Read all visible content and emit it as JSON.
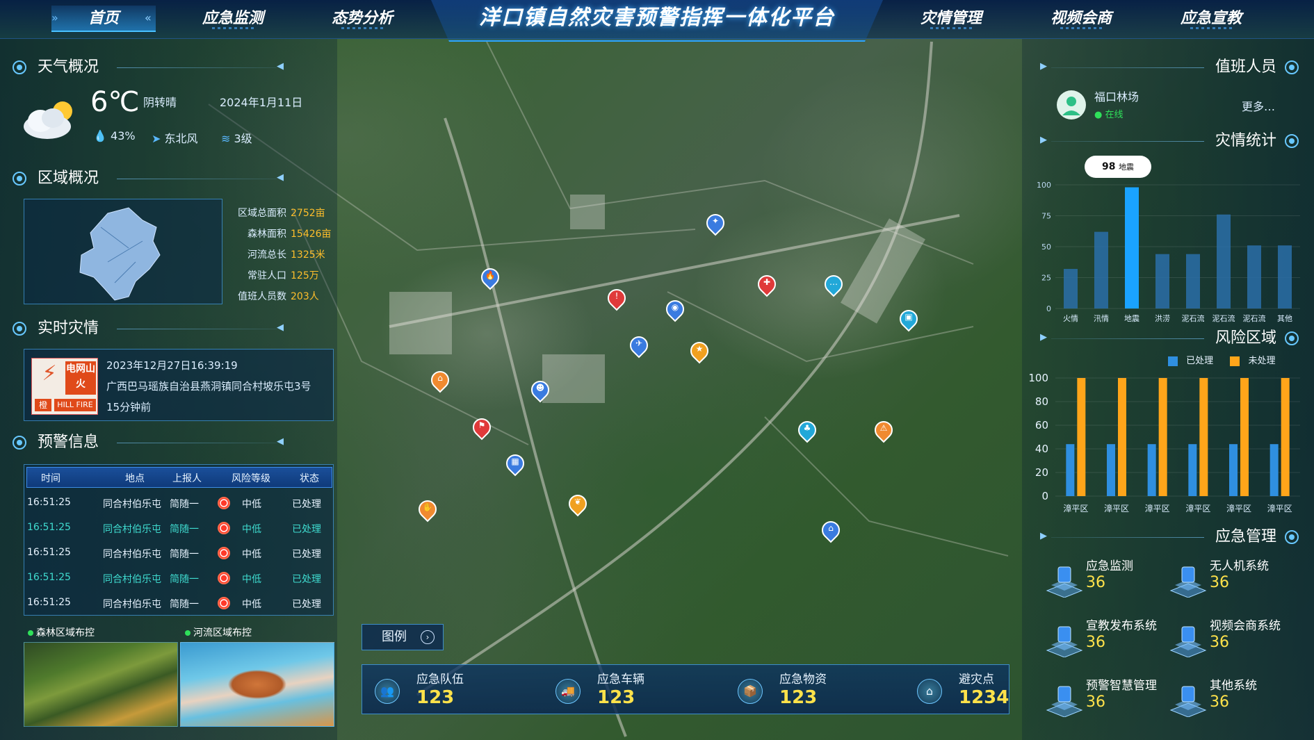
{
  "header": {
    "title": "洋口镇自然灾害预警指挥一体化平台",
    "nav_left": [
      {
        "label": "首页",
        "active": true
      },
      {
        "label": "应急监测"
      },
      {
        "label": "态势分析"
      }
    ],
    "nav_right": [
      {
        "label": "灾情管理"
      },
      {
        "label": "视频会商"
      },
      {
        "label": "应急宣教"
      }
    ]
  },
  "weather": {
    "section_title": "天气概况",
    "temp": "6℃",
    "desc": "阴转晴",
    "date": "2024年1月11日",
    "humidity": "43%",
    "wind_dir": "东北风",
    "wind_level": "3级",
    "icon": "cloud-sun-icon"
  },
  "region": {
    "section_title": "区域概况",
    "stats": [
      {
        "k": "区域总面积",
        "v": "2752亩"
      },
      {
        "k": "森林面积",
        "v": "15426亩"
      },
      {
        "k": "河流总长",
        "v": "1325米"
      },
      {
        "k": "常驻人口",
        "v": "125万"
      },
      {
        "k": "值班人员数",
        "v": "203人"
      }
    ]
  },
  "disaster": {
    "section_title": "实时灾情",
    "badge_top": "电网山火",
    "badge_bottom": "橙",
    "badge_en": "HILL FIRE",
    "time": "2023年12月27日16:39:19",
    "location": "广西巴马瑶族自治县燕洞镇同合村坡乐屯3号",
    "ago": "15分钟前"
  },
  "warning": {
    "section_title": "预警信息",
    "columns": [
      "时间",
      "地点",
      "上报人",
      "风险等级",
      "状态"
    ],
    "rows": [
      [
        "16:51:25",
        "同合村伯乐屯",
        "简随一",
        "中低",
        "已处理"
      ],
      [
        "16:51:25",
        "同合村伯乐屯",
        "简随一",
        "中低",
        "已处理"
      ],
      [
        "16:51:25",
        "同合村伯乐屯",
        "简随一",
        "中低",
        "已处理"
      ],
      [
        "16:51:25",
        "同合村伯乐屯",
        "简随一",
        "中低",
        "已处理"
      ],
      [
        "16:51:25",
        "同合村伯乐屯",
        "简随一",
        "中低",
        "已处理"
      ]
    ]
  },
  "thumbs": [
    {
      "label": "森林区域布控"
    },
    {
      "label": "河流区域布控"
    }
  ],
  "legend": {
    "label": "图例"
  },
  "resources": [
    {
      "label": "应急队伍",
      "value": "123",
      "icon": "team-icon"
    },
    {
      "label": "应急车辆",
      "value": "123",
      "icon": "truck-icon"
    },
    {
      "label": "应急物资",
      "value": "123",
      "icon": "supplies-icon"
    },
    {
      "label": "避灾点",
      "value": "1234",
      "icon": "shelter-icon"
    }
  ],
  "duty": {
    "section_title": "值班人员",
    "name": "福口林场",
    "status": "在线",
    "more": "更多…"
  },
  "stats_chart": {
    "section_title": "灾情统计",
    "tooltip_value": "98",
    "tooltip_label": "地震"
  },
  "risk_chart": {
    "section_title": "风险区域",
    "legend": [
      "已处理",
      "未处理"
    ]
  },
  "mgmt": {
    "section_title": "应急管理",
    "items": [
      {
        "label": "应急监测",
        "value": "36",
        "icon": "monitor-icon"
      },
      {
        "label": "无人机系统",
        "value": "36",
        "icon": "drone-icon"
      },
      {
        "label": "宣教发布系统",
        "value": "36",
        "icon": "broadcast-icon"
      },
      {
        "label": "视频会商系统",
        "value": "36",
        "icon": "video-icon"
      },
      {
        "label": "预警智慧管理",
        "value": "36",
        "icon": "warning-mgmt-icon"
      },
      {
        "label": "其他系统",
        "value": "36",
        "icon": "other-icon"
      }
    ]
  },
  "chart_data": [
    {
      "type": "bar",
      "title": "灾情统计",
      "categories": [
        "火情",
        "汛情",
        "地震",
        "洪涝",
        "泥石流",
        "泥石流",
        "泥石流",
        "其他"
      ],
      "values": [
        32,
        62,
        98,
        44,
        44,
        76,
        51,
        51
      ],
      "ylim": [
        0,
        100
      ],
      "yticks": [
        0,
        25,
        50,
        75,
        100
      ],
      "highlight_index": 2,
      "colors": {
        "bar": "#2a6ea8",
        "highlight": "#1aa3ff"
      }
    },
    {
      "type": "bar",
      "title": "风险区域",
      "categories": [
        "漳平区",
        "漳平区",
        "漳平区",
        "漳平区",
        "漳平区",
        "漳平区"
      ],
      "series": [
        {
          "name": "已处理",
          "values": [
            44,
            44,
            44,
            44,
            44,
            44
          ]
        },
        {
          "name": "未处理",
          "values": [
            100,
            100,
            100,
            100,
            100,
            100
          ]
        }
      ],
      "ylim": [
        0,
        100
      ],
      "yticks": [
        0,
        20,
        40,
        60,
        80,
        100
      ],
      "colors": {
        "已处理": "#2f8fe0",
        "未处理": "#ffa51a"
      }
    }
  ],
  "map_pins": [
    {
      "icon": "fire-icon",
      "color": "#3a7be0"
    },
    {
      "icon": "shield-icon",
      "color": "#3a7be0"
    },
    {
      "icon": "alarm-icon",
      "color": "#e03a3a"
    },
    {
      "icon": "camera-icon",
      "color": "#3a7be0"
    },
    {
      "icon": "hospital-icon",
      "color": "#e03a3a"
    },
    {
      "icon": "chat-icon",
      "color": "#22a8d8"
    },
    {
      "icon": "id-icon",
      "color": "#22a8d8"
    },
    {
      "icon": "bird-icon",
      "color": "#3a7be0"
    },
    {
      "icon": "star-icon",
      "color": "#f0a020"
    },
    {
      "icon": "home-icon",
      "color": "#f08a30"
    },
    {
      "icon": "person-icon",
      "color": "#3a7be0"
    },
    {
      "icon": "flag-icon",
      "color": "#e03a3a"
    },
    {
      "icon": "tree-icon",
      "color": "#22a8d8"
    },
    {
      "icon": "warning-icon",
      "color": "#f08a30"
    },
    {
      "icon": "building-icon",
      "color": "#3a7be0"
    },
    {
      "icon": "hand-icon",
      "color": "#f08a30"
    },
    {
      "icon": "leaf-icon",
      "color": "#f0a020"
    },
    {
      "icon": "bank-icon",
      "color": "#3a7be0"
    }
  ]
}
